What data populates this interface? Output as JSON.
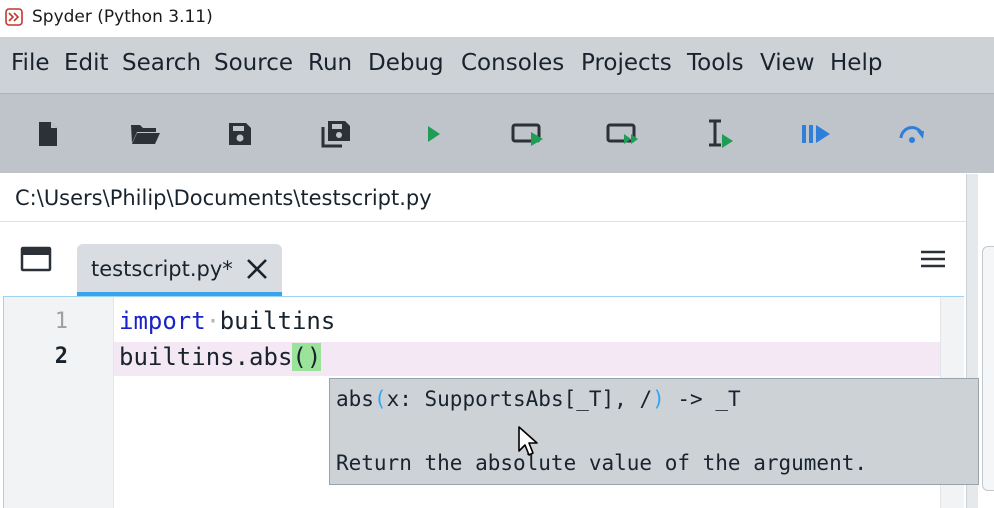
{
  "window": {
    "title": "Spyder (Python 3.11)"
  },
  "menubar": {
    "items": [
      "File",
      "Edit",
      "Search",
      "Source",
      "Run",
      "Debug",
      "Consoles",
      "Projects",
      "Tools",
      "View",
      "Help"
    ]
  },
  "toolbar": {
    "buttons": [
      {
        "name": "new-file",
        "icon": "new-file-icon"
      },
      {
        "name": "open-file",
        "icon": "open-folder-icon"
      },
      {
        "name": "save-file",
        "icon": "save-icon"
      },
      {
        "name": "save-all",
        "icon": "save-all-icon"
      },
      {
        "name": "run-file",
        "icon": "run-icon"
      },
      {
        "name": "run-cell",
        "icon": "run-cell-icon"
      },
      {
        "name": "run-cell-advance",
        "icon": "run-cell-advance-icon"
      },
      {
        "name": "run-selection",
        "icon": "run-selection-icon"
      },
      {
        "name": "debug-file",
        "icon": "debug-icon"
      },
      {
        "name": "step-over",
        "icon": "step-over-icon"
      }
    ]
  },
  "pathbar": {
    "path": "C:\\Users\\Philip\\Documents\\testscript.py"
  },
  "editor": {
    "tab": {
      "label": "testscript.py*",
      "close_icon": "close-icon"
    },
    "lines": [
      {
        "number": "1",
        "keyword": "import",
        "rest": "builtins"
      },
      {
        "number": "2",
        "prefix": "builtins.abs",
        "open_paren": "(",
        "close_paren": ")"
      }
    ]
  },
  "calltip": {
    "func": "abs",
    "open_paren": "(",
    "params": "x: SupportsAbs[_T], /",
    "close_paren": ")",
    "returns": " -> _T",
    "doc": "Return the absolute value of the argument."
  },
  "colors": {
    "accent": "#37a5ee",
    "keyword": "#1a23c8",
    "run_green": "#1f9d55",
    "debug_blue": "#2f7ed8",
    "menubar_bg": "#cdd2d7",
    "toolbar_bg": "#bec4ca",
    "paren_match": "#9be39b",
    "current_line": "#f4e8f4"
  }
}
